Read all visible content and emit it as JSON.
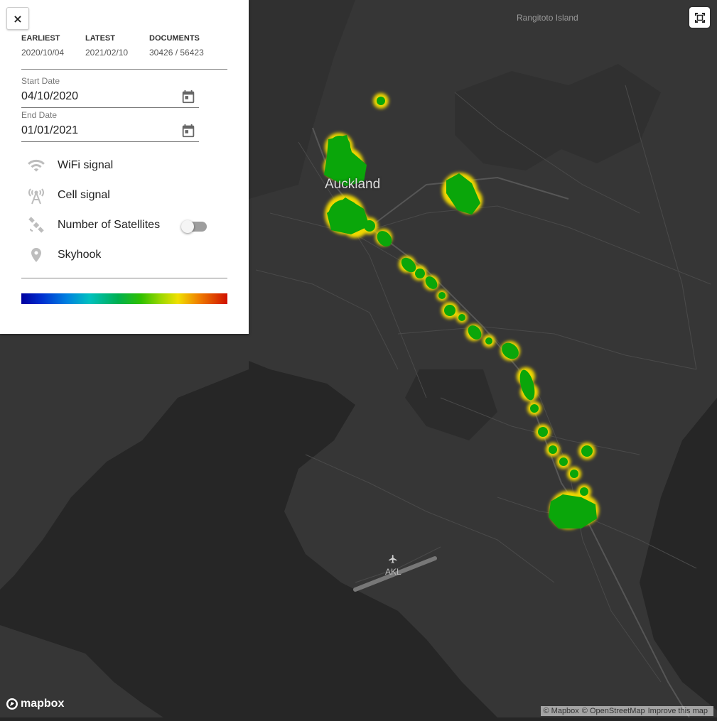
{
  "map": {
    "labels": {
      "rangitoto": "Rangitoto Island",
      "auckland": "Auckland",
      "airport": "AKL"
    },
    "attribution": [
      "© Mapbox",
      "© OpenStreetMap",
      "Improve this map"
    ],
    "logo_text": "mapbox"
  },
  "panel": {
    "close_label": "×",
    "stats": [
      {
        "label": "EARLIEST",
        "value": "2020/10/04"
      },
      {
        "label": "LATEST",
        "value": "2021/02/10"
      },
      {
        "label": "DOCUMENTS",
        "value": "30426 / 56423"
      }
    ],
    "start_date": {
      "label": "Start Date",
      "value": "04/10/2020"
    },
    "end_date": {
      "label": "End Date",
      "value": "01/01/2021"
    },
    "options": [
      {
        "label": "WiFi signal",
        "icon": "wifi-icon"
      },
      {
        "label": "Cell signal",
        "icon": "cell-tower-icon"
      },
      {
        "label": "Number of Satellites",
        "icon": "satellite-icon"
      },
      {
        "label": "Skyhook",
        "icon": "location-pin-icon"
      }
    ],
    "satellites_toggle": false
  },
  "colors": {
    "heat_core": "#0aa60a",
    "heat_edge": "#f0d800",
    "map_background": "#262626"
  }
}
